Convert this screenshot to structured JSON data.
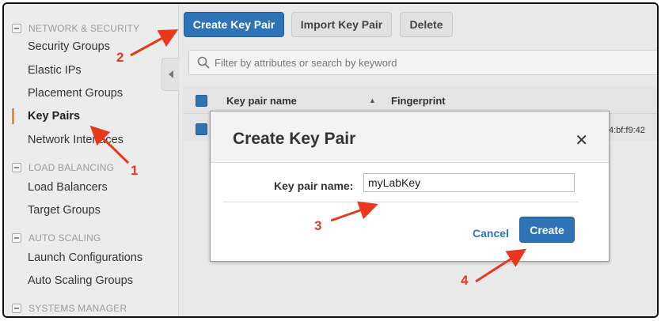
{
  "sidebar": {
    "sections": [
      {
        "label": "NETWORK & SECURITY"
      },
      {
        "label": "LOAD BALANCING"
      },
      {
        "label": "AUTO SCALING"
      },
      {
        "label": "SYSTEMS MANAGER"
      }
    ],
    "items": [
      {
        "label": "Security Groups"
      },
      {
        "label": "Elastic IPs"
      },
      {
        "label": "Placement Groups"
      },
      {
        "label": "Key Pairs"
      },
      {
        "label": "Network Interfaces"
      },
      {
        "label": "Load Balancers"
      },
      {
        "label": "Target Groups"
      },
      {
        "label": "Launch Configurations"
      },
      {
        "label": "Auto Scaling Groups"
      }
    ],
    "active_item": "Key Pairs"
  },
  "toolbar": {
    "create_label": "Create Key Pair",
    "import_label": "Import Key Pair",
    "delete_label": "Delete"
  },
  "filter": {
    "placeholder": "Filter by attributes or search by keyword"
  },
  "table": {
    "columns": [
      "Key pair name",
      "Fingerprint"
    ],
    "sort_indicator": "▲",
    "rows": [
      {
        "fingerprint_partial": "4:bf:f9:42"
      }
    ]
  },
  "modal": {
    "title": "Create Key Pair",
    "close_glyph": "✕",
    "field_label": "Key pair name:",
    "field_value": "myLabKey",
    "cancel_label": "Cancel",
    "create_label": "Create"
  },
  "annotations": {
    "numbers": [
      "1",
      "2",
      "3",
      "4"
    ],
    "color": "#e8391d"
  },
  "colors": {
    "primary_blue": "#2f73b7",
    "active_accent": "#e8902e"
  }
}
